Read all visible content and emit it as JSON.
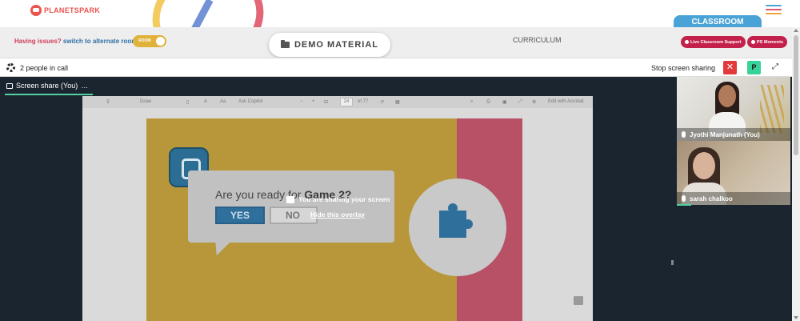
{
  "app": {
    "logo_text": "PLANETSPARK"
  },
  "header": {
    "classroom_tab": "CLASSROOM",
    "issues_text": "Having issues?",
    "switch_room_text": "switch to alternate room",
    "room_toggle_label": "ROOM",
    "demo_material": "DEMO MATERIAL",
    "curriculum": "CURRICULUM",
    "live_support": "Live Classroom Support",
    "ps_moments": "PS Moments"
  },
  "call": {
    "people_count": "2 people in call",
    "stop_sharing": "Stop screen sharing",
    "close_label": "✕",
    "p_label": "P",
    "share_tab": "Screen share (You)",
    "share_tab_more": "…"
  },
  "pdf": {
    "toolbar": {
      "draw": "Draw",
      "copilot": "Ask Copilot",
      "page": "24",
      "of_pages": "of 77",
      "edit": "Edit with Acrobat"
    }
  },
  "slide": {
    "question_prefix": "Are you ready for",
    "question_game": "Game 2?",
    "yes": "YES",
    "no": "NO"
  },
  "overlay": {
    "message": "You are sharing your screen",
    "hide": "Hide this overlay"
  },
  "participants": [
    {
      "name": "Jyothi Manjunath (You)"
    },
    {
      "name": "sarah chalkoo"
    }
  ],
  "colors": {
    "brand_red": "#e8554e",
    "classroom_blue": "#4aa3d6",
    "pill_red": "#c3204b",
    "toggle_yellow": "#e0b23a",
    "call_dark": "#1b2530",
    "stop_red": "#e23a3a",
    "p_green": "#37d39a"
  }
}
